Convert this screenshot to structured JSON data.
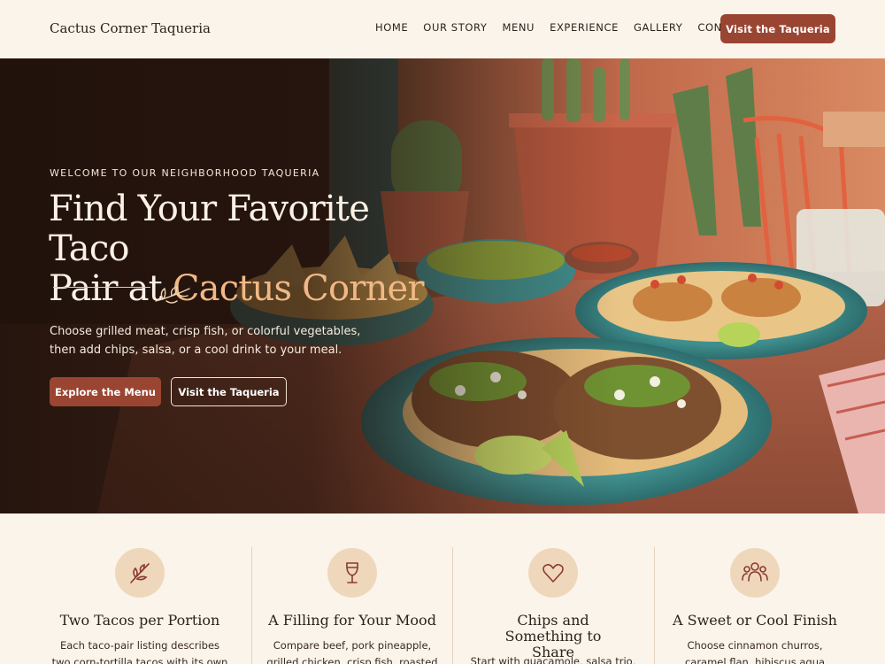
{
  "brand": "Cactus Corner Taqueria",
  "nav": {
    "items": [
      "HOME",
      "OUR STORY",
      "MENU",
      "EXPERIENCE",
      "GALLERY",
      "CONTACT"
    ],
    "cta": "Visit the Taqueria"
  },
  "hero": {
    "eyebrow": "WELCOME TO OUR NEIGHBORHOOD TAQUERIA",
    "headline_line1": "Find Your Favorite Taco",
    "headline_line2_pre": "Pair at ",
    "headline_line2_accent": "Cactus Corner",
    "intro": "Choose grilled meat, crisp fish, or colorful vegetables, then add chips, salsa, or a cool drink to your meal.",
    "primary_button": "Explore the Menu",
    "secondary_button": "Visit the Taqueria"
  },
  "features": [
    {
      "icon": "sprig-icon",
      "title": "Two Tacos per Portion",
      "body": "Each taco-pair listing describes two corn-tortilla tacos with its own filling:"
    },
    {
      "icon": "wine-glass-icon",
      "title": "A Filling for Your Mood",
      "body": "Compare beef, pork pineapple, grilled chicken, crisp fish, roasted"
    },
    {
      "icon": "heart-icon",
      "title": "Chips and Something to Share",
      "body": "Start with guacamole, salsa trio, or"
    },
    {
      "icon": "people-icon",
      "title": "A Sweet or Cool Finish",
      "body": "Choose cinnamon churros, caramel flan, hibiscus agua fresca, or our"
    }
  ],
  "colors": {
    "accent": "#9a4532",
    "background": "#fbf4ea",
    "headline_accent": "#f1b885",
    "icon_badge": "#efd7bc"
  }
}
